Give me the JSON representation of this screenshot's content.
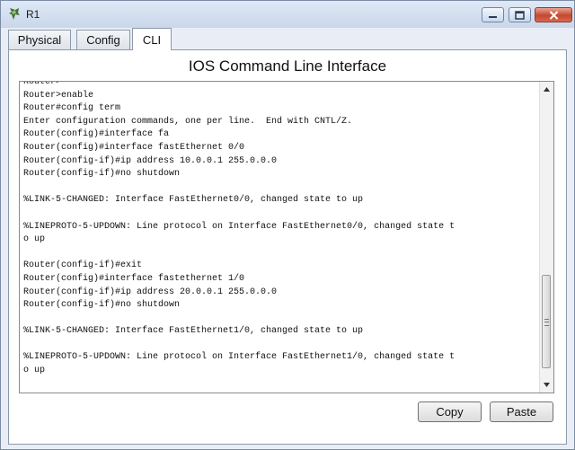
{
  "window": {
    "title": "R1"
  },
  "tabs": [
    {
      "label": "Physical",
      "active": false
    },
    {
      "label": "Config",
      "active": false
    },
    {
      "label": "CLI",
      "active": true
    }
  ],
  "panel": {
    "title": "IOS Command Line Interface"
  },
  "terminal": {
    "lines": [
      "Router>",
      "Router>enable",
      "Router#config term",
      "Enter configuration commands, one per line.  End with CNTL/Z.",
      "Router(config)#interface fa",
      "Router(config)#interface fastEthernet 0/0",
      "Router(config-if)#ip address 10.0.0.1 255.0.0.0",
      "Router(config-if)#no shutdown",
      "",
      "%LINK-5-CHANGED: Interface FastEthernet0/0, changed state to up",
      "",
      "%LINEPROTO-5-UPDOWN: Line protocol on Interface FastEthernet0/0, changed state t",
      "o up",
      "",
      "Router(config-if)#exit",
      "Router(config)#interface fastethernet 1/0",
      "Router(config-if)#ip address 20.0.0.1 255.0.0.0",
      "Router(config-if)#no shutdown",
      "",
      "%LINK-5-CHANGED: Interface FastEthernet1/0, changed state to up",
      "",
      "%LINEPROTO-5-UPDOWN: Line protocol on Interface FastEthernet1/0, changed state t",
      "o up"
    ]
  },
  "buttons": {
    "copy": "Copy",
    "paste": "Paste"
  },
  "icons": {
    "app": "router-icon",
    "minimize": "minimize-icon",
    "maximize": "maximize-icon",
    "close": "close-icon",
    "scroll_up": "scroll-up-arrow-icon",
    "scroll_down": "scroll-down-arrow-icon"
  },
  "colors": {
    "titlebar": "#dfe9f6",
    "close_button": "#c5472f",
    "panel_background": "#ffffff"
  }
}
